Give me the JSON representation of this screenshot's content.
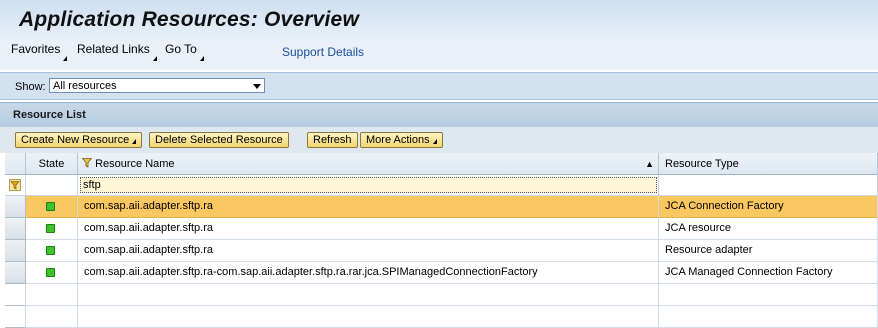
{
  "header": {
    "title": "Application Resources: Overview"
  },
  "nav": {
    "favorites": "Favorites",
    "related_links": "Related Links",
    "go_to": "Go To",
    "support_details": "Support Details"
  },
  "show": {
    "label": "Show:",
    "value": "All resources"
  },
  "list": {
    "title": "Resource List",
    "toolbar": {
      "create": "Create New Resource",
      "delete": "Delete Selected Resource",
      "refresh": "Refresh",
      "more": "More Actions"
    },
    "columns": {
      "state": "State",
      "name": "Resource Name",
      "type": "Resource Type"
    },
    "filter": {
      "name": "sftp"
    },
    "rows": [
      {
        "state": "green",
        "name": "com.sap.aii.adapter.sftp.ra",
        "type": "JCA Connection Factory"
      },
      {
        "state": "green",
        "name": "com.sap.aii.adapter.sftp.ra",
        "type": "JCA resource"
      },
      {
        "state": "green",
        "name": "com.sap.aii.adapter.sftp.ra",
        "type": "Resource adapter"
      },
      {
        "state": "green",
        "name": "com.sap.aii.adapter.sftp.ra-com.sap.aii.adapter.sftp.ra.rar.jca.SPIManagedConnectionFactory",
        "type": "JCA Managed Connection Factory"
      }
    ]
  },
  "colors": {
    "selected_row": "#fbc760",
    "status_green": "#3ec42a",
    "link": "#1c4fa0"
  }
}
